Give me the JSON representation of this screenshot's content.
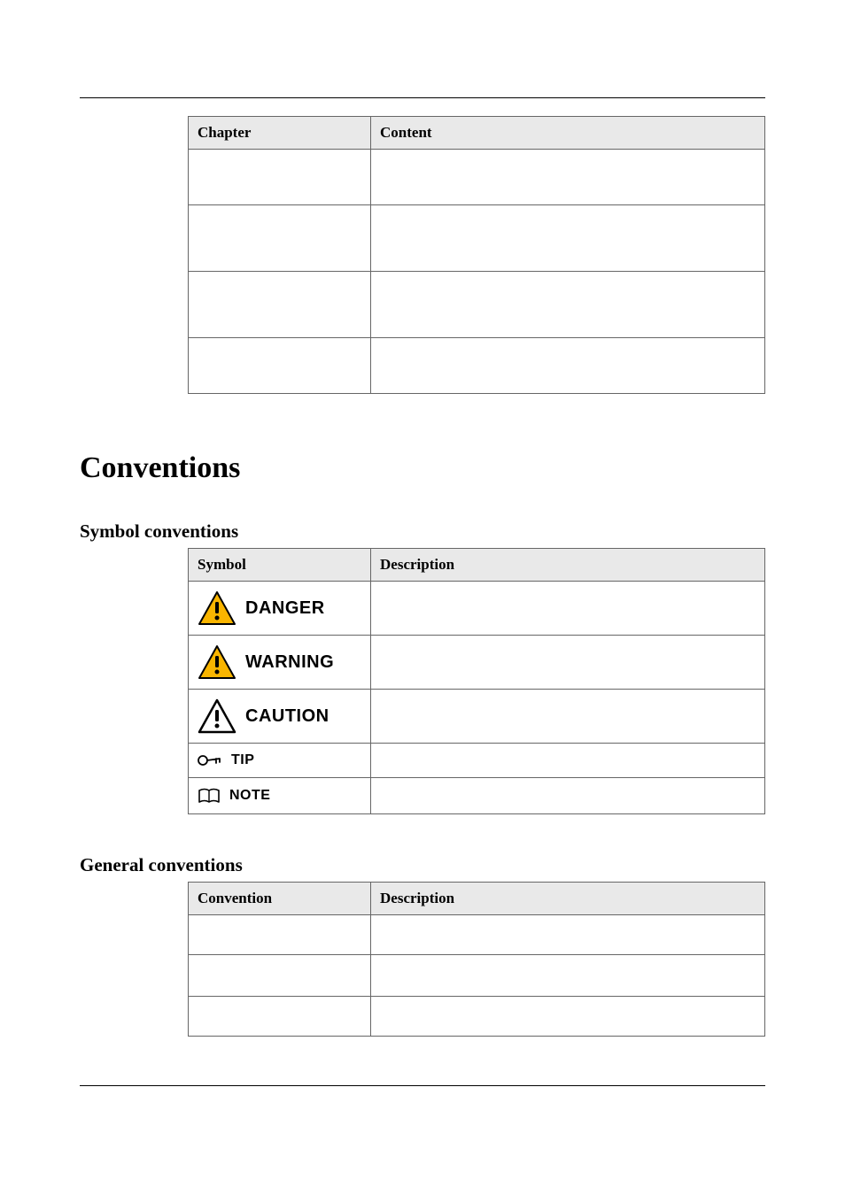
{
  "table1": {
    "headers": {
      "col1": "Chapter",
      "col2": "Content"
    },
    "rows": [
      {
        "c1": "",
        "c2": ""
      },
      {
        "c1": "",
        "c2": ""
      },
      {
        "c1": "",
        "c2": ""
      },
      {
        "c1": "",
        "c2": ""
      }
    ]
  },
  "sections": {
    "conventions": "Conventions",
    "symbol": "Symbol conventions",
    "general": "General conventions"
  },
  "table2": {
    "headers": {
      "col1": "Symbol",
      "col2": "Description"
    },
    "labels": {
      "danger": "DANGER",
      "warning": "WARNING",
      "caution": "CAUTION",
      "tip": "TIP",
      "note": "NOTE"
    }
  },
  "table3": {
    "headers": {
      "col1": "Convention",
      "col2": "Description"
    },
    "rows": [
      {
        "c1": "",
        "c2": ""
      },
      {
        "c1": "",
        "c2": ""
      },
      {
        "c1": "",
        "c2": ""
      }
    ]
  }
}
